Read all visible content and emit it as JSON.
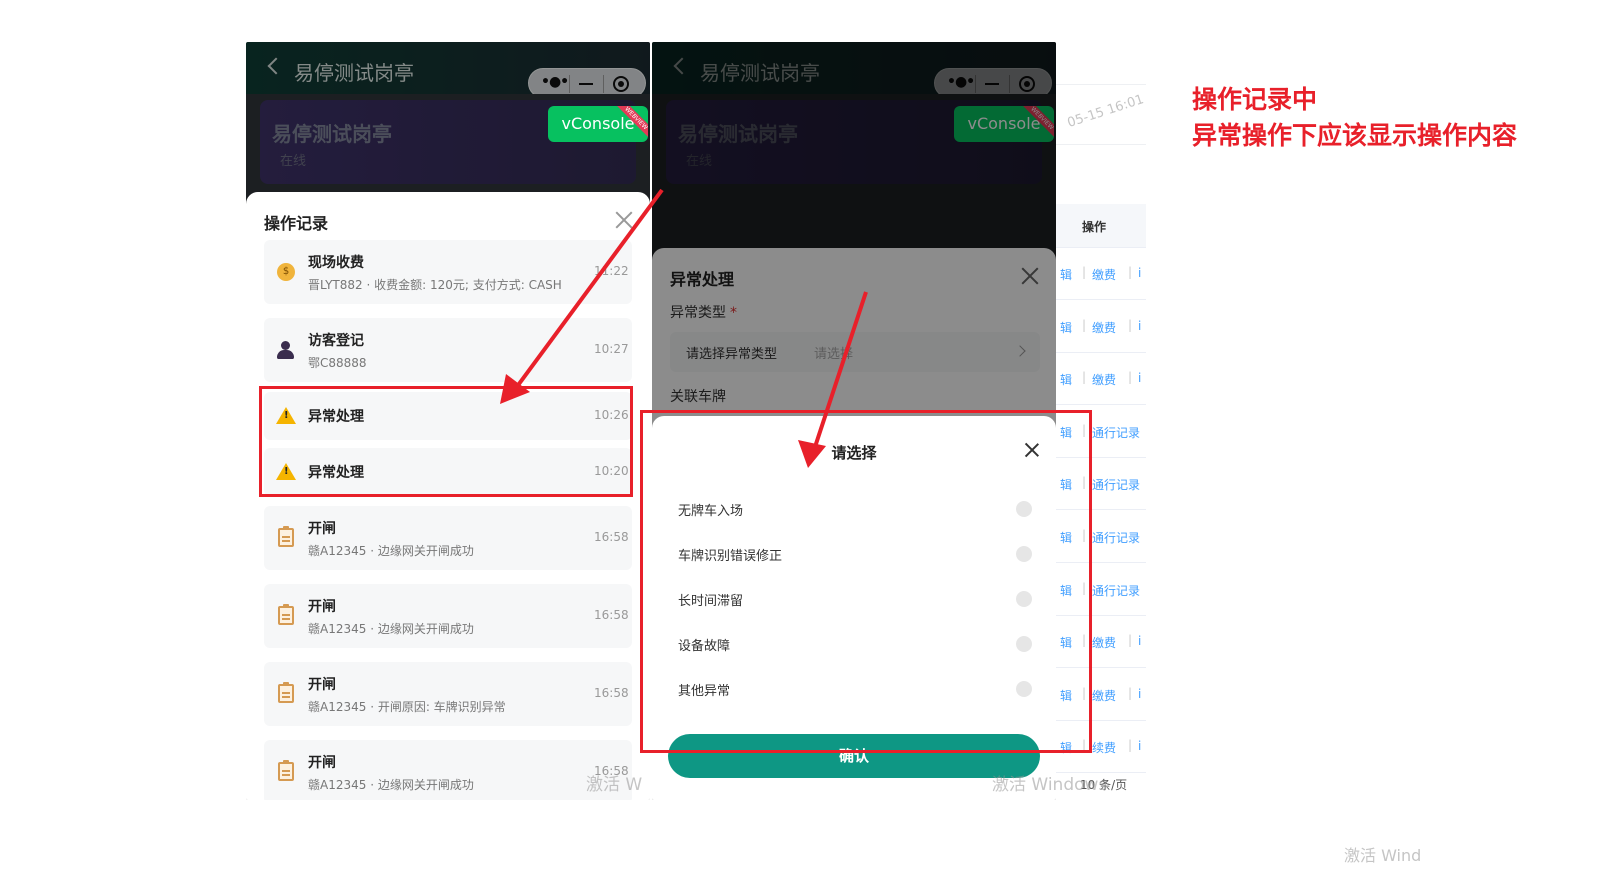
{
  "annotation": {
    "line1": "操作记录中",
    "line2": "异常操作下应该显示操作内容",
    "color": "#e8202a"
  },
  "left_phone": {
    "header_title": "易停测试岗亭",
    "station_name": "易停测试岗亭",
    "station_status": "在线",
    "vconsole": "vConsole",
    "vconsole_badge": "WEBVIEW",
    "log_sheet": {
      "title": "操作记录",
      "items": [
        {
          "icon": "coin-icon",
          "name": "现场收费",
          "desc": "晋LYT882 · 收费金额: 120元; 支付方式: CASH",
          "time": "11:22"
        },
        {
          "icon": "user-icon",
          "name": "访客登记",
          "desc": "鄂C88888",
          "time": "10:27"
        },
        {
          "icon": "warning-icon",
          "name": "异常处理",
          "desc": "",
          "time": "10:26"
        },
        {
          "icon": "warning-icon",
          "name": "异常处理",
          "desc": "",
          "time": "10:20"
        },
        {
          "icon": "clipboard-icon",
          "name": "开闸",
          "desc": "赣A12345 · 边缘网关开闸成功",
          "time": "16:58"
        },
        {
          "icon": "clipboard-icon",
          "name": "开闸",
          "desc": "赣A12345 · 边缘网关开闸成功",
          "time": "16:58"
        },
        {
          "icon": "clipboard-icon",
          "name": "开闸",
          "desc": "赣A12345 · 开闸原因: 车牌识别异常",
          "time": "16:58"
        },
        {
          "icon": "clipboard-icon",
          "name": "开闸",
          "desc": "赣A12345 · 边缘网关开闸成功",
          "time": "16:58"
        }
      ]
    }
  },
  "right_phone": {
    "header_title": "易停测试岗亭",
    "station_name": "易停测试岗亭",
    "station_status": "在线",
    "vconsole": "vConsole",
    "vconsole_badge": "WEBVIEW",
    "form": {
      "title": "异常处理",
      "type_label": "异常类型",
      "required_mark": "*",
      "type_field_label": "请选择异常类型",
      "type_field_placeholder": "请选择",
      "plate_label": "关联车牌"
    },
    "picker": {
      "title": "请选择",
      "options": [
        "无牌车入场",
        "车牌识别错误修正",
        "长时间滞留",
        "设备故障",
        "其他异常"
      ],
      "confirm": "确认"
    }
  },
  "background_table": {
    "header": "操作",
    "rows": [
      {
        "a": "辑",
        "b": "缴费",
        "c": "i"
      },
      {
        "a": "辑",
        "b": "缴费",
        "c": "i"
      },
      {
        "a": "辑",
        "b": "缴费",
        "c": "i"
      },
      {
        "a": "辑",
        "b": "通行记录",
        "c": ""
      },
      {
        "a": "辑",
        "b": "通行记录",
        "c": ""
      },
      {
        "a": "辑",
        "b": "通行记录",
        "c": ""
      },
      {
        "a": "辑",
        "b": "通行记录",
        "c": ""
      },
      {
        "a": "辑",
        "b": "缴费",
        "c": "i"
      },
      {
        "a": "辑",
        "b": "缴费",
        "c": "i"
      },
      {
        "a": "辑",
        "b": "续费",
        "c": "i"
      }
    ],
    "pager": "10 条/页",
    "faint_timestamp": "05-15 16:01"
  },
  "watermark": {
    "text_a": "激活 Windows",
    "text_b": "激活 W",
    "text_c": "激活 Wind"
  }
}
